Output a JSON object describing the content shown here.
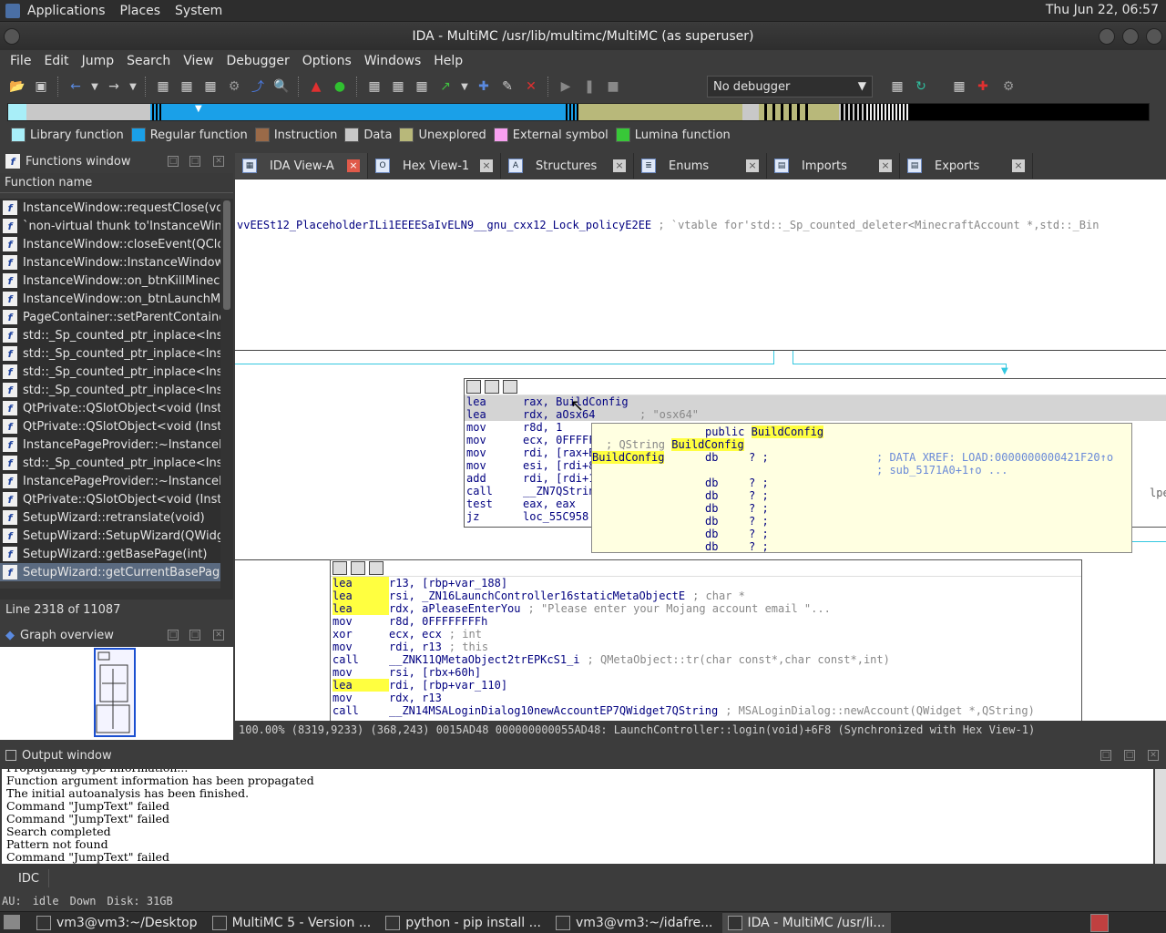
{
  "panel": {
    "menus": [
      "Applications",
      "Places",
      "System"
    ],
    "clock": "Thu Jun 22, 06:57"
  },
  "window": {
    "title": "IDA - MultiMC /usr/lib/multimc/MultiMC (as superuser)"
  },
  "menubar": [
    "File",
    "Edit",
    "Jump",
    "Search",
    "View",
    "Debugger",
    "Options",
    "Windows",
    "Help"
  ],
  "toolbar": {
    "debugger_value": "No debugger"
  },
  "legend": [
    {
      "label": "Library function",
      "color": "#a8eef8"
    },
    {
      "label": "Regular function",
      "color": "#1aa0e8"
    },
    {
      "label": "Instruction",
      "color": "#9a6a48"
    },
    {
      "label": "Data",
      "color": "#c8c8c8"
    },
    {
      "label": "Unexplored",
      "color": "#b8b87a"
    },
    {
      "label": "External symbol",
      "color": "#f8a0f0"
    },
    {
      "label": "Lumina function",
      "color": "#38c838"
    }
  ],
  "functions": {
    "title": "Functions window",
    "column": "Function name",
    "items": [
      "InstanceWindow::requestClose(void)",
      "`non-virtual thunk to'InstanceWindow::closeEvent(QCloseEvent *)",
      "InstanceWindow::closeEvent(QCloseEvent *)",
      "InstanceWindow::InstanceWindow(std::shared_ptr<BaseInstance>,QWidget *)",
      "InstanceWindow::on_btnKillMinecraft_clicked(void)",
      "InstanceWindow::on_btnLaunchMinecraftOffline_clicked(void)",
      "PageContainer::setParentContainer(BasePageContainer *)",
      "std::_Sp_counted_ptr_inplace<InstancePageProvider>",
      "std::_Sp_counted_ptr_inplace<InstancePageProvider>",
      "std::_Sp_counted_ptr_inplace<InstancePageProvider>",
      "std::_Sp_counted_ptr_inplace<InstancePageProvider>",
      "QtPrivate::QSlotObject<void (InstanceWindow::*)(void)>",
      "QtPrivate::QSlotObject<void (InstanceWindow::*)(void)>",
      "InstancePageProvider::~InstancePageProvider()",
      "std::_Sp_counted_ptr_inplace<InstancePageProvider>",
      "InstancePageProvider::~InstancePageProvider()",
      "QtPrivate::QSlotObject<void (InstanceWindow::*)(void)>",
      "SetupWizard::retranslate(void)",
      "SetupWizard::SetupWizard(QWidget *)",
      "SetupWizard::getBasePage(int)",
      "SetupWizard::getCurrentBasePage(void)"
    ],
    "selected_index": 20,
    "line_status": "Line 2318 of 11087"
  },
  "overview": {
    "title": "Graph overview"
  },
  "tabs": [
    {
      "label": "IDA View-A",
      "icon": "graph-icon"
    },
    {
      "label": "Hex View-1",
      "icon": "hex-icon"
    },
    {
      "label": "Structures",
      "icon": "struct-icon"
    },
    {
      "label": "Enums",
      "icon": "enum-icon"
    },
    {
      "label": "Imports",
      "icon": "import-icon"
    },
    {
      "label": "Exports",
      "icon": "export-icon"
    }
  ],
  "view": {
    "top_line": "vvEESt12_PlaceholderILi1EEEESaIvELN9__gnu_cxx12_Lock_policyE2EE",
    "top_comment": "; `vtable for'std::_Sp_counted_deleter<MinecraftAccount *,std::_Bin",
    "node1": [
      {
        "m": "lea",
        "o": "rax, BuildConfig"
      },
      {
        "m": "lea",
        "o": "rdx, aOsx64",
        "c": "; \"osx64\""
      },
      {
        "m": "mov",
        "o": "r8d, 1"
      },
      {
        "m": "mov",
        "o": "ecx, 0FFFFFFFFh",
        "c": "; QString"
      },
      {
        "m": "mov",
        "o": "rdi, [rax+BuildConfig]"
      },
      {
        "m": "mov",
        "o": "esi, [rdi+8]"
      },
      {
        "m": "add",
        "o": "rdi, [rdi+10h]"
      },
      {
        "m": "call",
        "o": "__ZN7QString"
      },
      {
        "m": "test",
        "o": "eax, eax"
      },
      {
        "m": "jz",
        "o": "loc_55C958"
      }
    ],
    "node1_tail": "lper",
    "tooltip": {
      "l1a": "public",
      "l1b": "BuildConfig",
      "l2a": "; QString",
      "l2b": "BuildConfig",
      "l3a": "BuildConfig",
      "l3b": "db",
      "l3c": "? ;",
      "l3d": "; DATA XREF: LOAD:0000000000421F20↑o",
      "l4": "; sub_5171A0+1↑o ...",
      "db": "db",
      "q": "? ;"
    },
    "node2": [
      {
        "m": "lea",
        "o": "r13, [rbp+var_188]",
        "hl": true
      },
      {
        "m": "lea",
        "o": "rsi, _ZN16LaunchController16staticMetaObjectE",
        "c": "; char *",
        "hl": true
      },
      {
        "m": "lea",
        "o": "rdx, aPleaseEnterYou",
        "c": "; \"Please enter your Mojang account email \"...",
        "hl": true
      },
      {
        "m": "mov",
        "o": "r8d, 0FFFFFFFFh"
      },
      {
        "m": "xor",
        "o": "ecx, ecx",
        "c": "; int"
      },
      {
        "m": "mov",
        "o": "rdi, r13",
        "c": "; this"
      },
      {
        "m": "call",
        "o": "__ZNK11QMetaObject2trEPKcS1_i",
        "c": "; QMetaObject::tr(char const*,char const*,int)"
      },
      {
        "m": "mov",
        "o": "rsi, [rbx+60h]"
      },
      {
        "m": "lea",
        "o": "rdi, [rbp+var_110]",
        "hl": true
      },
      {
        "m": "mov",
        "o": "rdx, r13"
      },
      {
        "m": "call",
        "o": "__ZN14MSALoginDialog10newAccountEP7QWidget7QString",
        "c": "; MSALoginDialog::newAccount(QWidget *,QString)"
      }
    ],
    "status": "100.00% (8319,9233) (368,243) 0015AD48 000000000055AD48: LaunchController::login(void)+6F8 (Synchronized with Hex View-1)"
  },
  "output": {
    "title": "Output window",
    "lines": [
      "Propagating type information...",
      "Function argument information has been propagated",
      "The initial autoanalysis has been finished.",
      "Command \"JumpText\" failed",
      "Command \"JumpText\" failed",
      "Search completed",
      "Pattern not found",
      "Command \"JumpText\" failed"
    ],
    "idc": "IDC"
  },
  "status": {
    "au": "AU:",
    "au_state": "idle",
    "dir": "Down",
    "disk": "Disk: 31GB"
  },
  "taskbar": [
    {
      "label": "vm3@vm3:~/Desktop",
      "icon": "terminal-icon"
    },
    {
      "label": "MultiMC 5 - Version ...",
      "icon": "multimc-icon"
    },
    {
      "label": "python - pip install ...",
      "icon": "chrome-icon"
    },
    {
      "label": "vm3@vm3:~/idafre...",
      "icon": "terminal-icon"
    },
    {
      "label": "IDA - MultiMC /usr/li...",
      "icon": "ida-icon",
      "active": true
    }
  ]
}
